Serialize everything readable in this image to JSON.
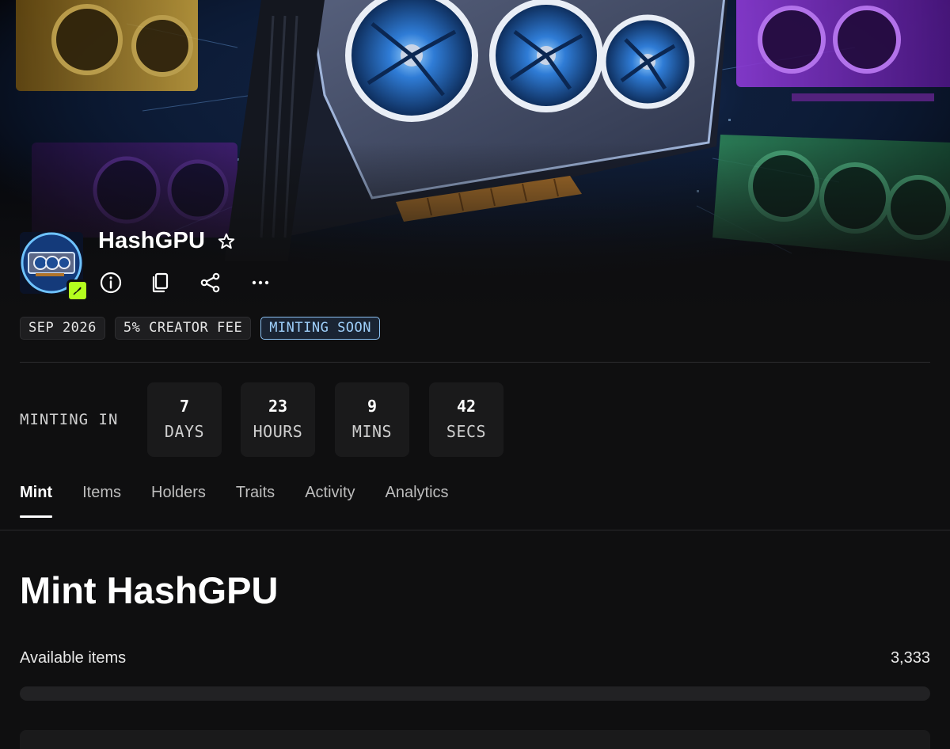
{
  "collection": {
    "name": "HashGPU",
    "tags": [
      "SEP 2026",
      "5% CREATOR FEE",
      "MINTING SOON"
    ]
  },
  "countdown": {
    "label": "MINTING IN",
    "units": [
      {
        "value": "7",
        "unit": "DAYS"
      },
      {
        "value": "23",
        "unit": "HOURS"
      },
      {
        "value": "9",
        "unit": "MINS"
      },
      {
        "value": "42",
        "unit": "SECS"
      }
    ]
  },
  "tabs": [
    "Mint",
    "Items",
    "Holders",
    "Traits",
    "Activity",
    "Analytics"
  ],
  "active_tab": "Mint",
  "mint": {
    "title": "Mint HashGPU",
    "available_label": "Available items",
    "available_value": "3,333",
    "progress_fraction": 0
  },
  "icons": {
    "favorite": "star-outline-icon",
    "info": "info-icon",
    "copy": "copy-icon",
    "share": "share-icon",
    "more": "more-horizontal-icon",
    "badge": "feather-icon"
  },
  "colors": {
    "accent_tag": "#8cc2f4",
    "badge": "#b4ff1e",
    "background": "#0f0f10"
  }
}
